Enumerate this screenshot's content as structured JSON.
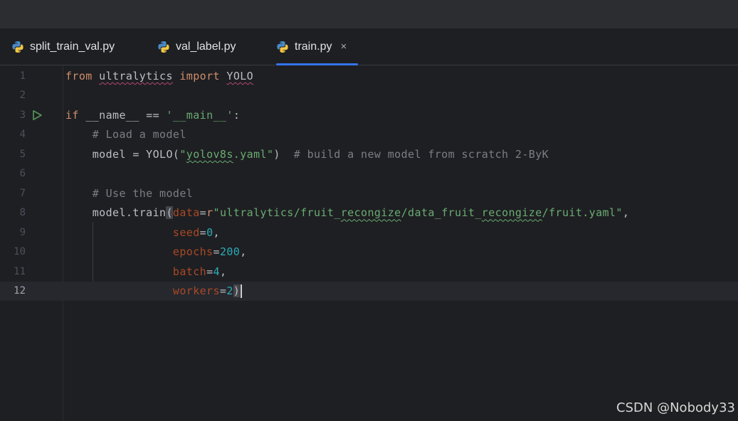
{
  "tabs": [
    {
      "label": "split_train_val.py",
      "icon": "python-file-icon"
    },
    {
      "label": "val_label.py",
      "icon": "python-file-icon"
    },
    {
      "label": "train.py",
      "icon": "python-file-icon",
      "active": true,
      "close": "×"
    }
  ],
  "line_numbers": [
    "1",
    "2",
    "3",
    "4",
    "5",
    "6",
    "7",
    "8",
    "9",
    "10",
    "11",
    "12"
  ],
  "code": {
    "l1": {
      "kw1": "from",
      "mod": "ultralytics",
      "kw2": "import",
      "cls": "YOLO"
    },
    "l3": {
      "kw": "if",
      "name": "__name__",
      "op": "==",
      "str": "'__main__'",
      "colon": ":"
    },
    "l4": {
      "cmt": "# Load a model"
    },
    "l5": {
      "pre": "model = YOLO(",
      "str_q1": "\"",
      "str_body": "yolov8s",
      "str_rest": ".yaml\"",
      "post": ")",
      "cmt": "# build a new model from scratch 2-ByK"
    },
    "l7": {
      "cmt": "# Use the model"
    },
    "l8": {
      "pre": "model.train",
      "paren": "(",
      "param": "data",
      "eq": "=",
      "prefix": "r",
      "s1": "\"ultralytics/fruit_",
      "s2": "recongize",
      "s3": "/data_fruit_",
      "s4": "recongize",
      "s5": "/fruit.yaml\"",
      "comma": ","
    },
    "l9": {
      "param": "seed",
      "eq": "=",
      "val": "0",
      "comma": ","
    },
    "l10": {
      "param": "epochs",
      "eq": "=",
      "val": "200",
      "comma": ","
    },
    "l11": {
      "param": "batch",
      "eq": "=",
      "val": "4",
      "comma": ","
    },
    "l12": {
      "param": "workers",
      "eq": "=",
      "val": "2",
      "paren": ")"
    }
  },
  "watermark": "CSDN @Nobody33",
  "colors": {
    "keyword": "#cf8e6d",
    "string": "#6aab73",
    "number": "#2aacb8",
    "comment": "#7a7e85",
    "parameter": "#aa4926",
    "accent": "#3574f0"
  }
}
